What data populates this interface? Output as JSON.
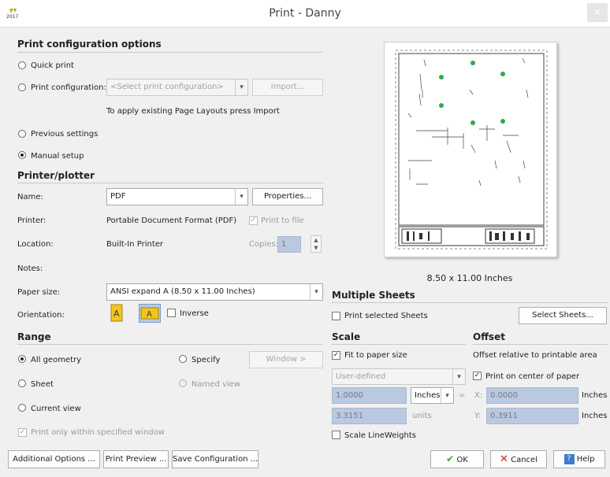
{
  "window": {
    "title": "Print - Danny",
    "app_icon_label": "2017"
  },
  "print_config": {
    "heading": "Print configuration options",
    "quick_print": "Quick print",
    "print_configuration": "Print configuration:",
    "config_placeholder": "<Select print configuration>",
    "import_button": "Import...",
    "hint": "To apply existing Page Layouts press Import",
    "previous_settings": "Previous settings",
    "manual_setup": "Manual setup",
    "selected_mode": "Manual setup"
  },
  "printer": {
    "heading": "Printer/plotter",
    "name_label": "Name:",
    "name_value": "PDF",
    "properties_button": "Properties...",
    "printer_label": "Printer:",
    "printer_value": "Portable Document Format (PDF)",
    "print_to_file": "Print to file",
    "location_label": "Location:",
    "location_value": "Built-In Printer",
    "copies_label": "Copies:",
    "copies_value": "1",
    "notes_label": "Notes:",
    "paper_size_label": "Paper size:",
    "paper_size_value": "ANSI expand A (8.50 x 11.00 Inches)",
    "orientation_label": "Orientation:",
    "inverse_label": "Inverse"
  },
  "range": {
    "heading": "Range",
    "all_geometry": "All geometry",
    "specify": "Specify",
    "window_button": "Window >",
    "sheet": "Sheet",
    "named_view": "Named view",
    "current_view": "Current view",
    "only_within_window": "Print only within specified window"
  },
  "preview": {
    "size_caption": "8.50 x 11.00 Inches"
  },
  "multiple_sheets": {
    "heading": "Multiple Sheets",
    "print_selected": "Print selected Sheets",
    "select_button": "Select Sheets..."
  },
  "scale": {
    "heading": "Scale",
    "fit_to_paper": "Fit to paper size",
    "scale_type": "User-defined",
    "value1": "1.0000",
    "unit": "Inches",
    "equals": "=",
    "value2": "3.3151",
    "units_label": "units",
    "scale_lineweights": "Scale LineWeights"
  },
  "offset": {
    "heading": "Offset",
    "subtitle": "Offset relative to printable area",
    "center": "Print on center of paper",
    "x_label": "X:",
    "x_value": "0.0000",
    "x_unit": "Inches",
    "y_label": "Y:",
    "y_value": "0.3911",
    "y_unit": "Inches"
  },
  "footer": {
    "additional_options": "Additional Options ...",
    "print_preview": "Print Preview ...",
    "save_configuration": "Save Configuration ...",
    "ok": "OK",
    "cancel": "Cancel",
    "help": "Help"
  },
  "colors": {
    "accent_blue": "#b9c9e1",
    "ok_green": "#3aa535",
    "cancel_red": "#d42020",
    "help_blue": "#3d7cc9"
  }
}
